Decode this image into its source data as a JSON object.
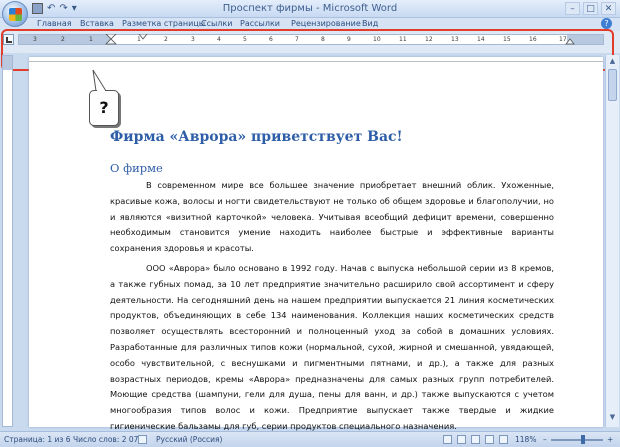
{
  "window": {
    "title": "Проспект фирмы - Microsoft Word",
    "controls": {
      "minimize": "–",
      "maximize": "□",
      "close": "✕"
    }
  },
  "qat": {
    "undo": "↶",
    "redo": "↷",
    "more": "▾"
  },
  "ribbon": {
    "tabs": [
      "Главная",
      "Вставка",
      "Разметка страницы",
      "Ссылки",
      "Рассылки",
      "Рецензирование",
      "Вид"
    ],
    "help": "?"
  },
  "ruler": {
    "ticks": [
      "3",
      "2",
      "1",
      "1",
      "2",
      "3",
      "4",
      "5",
      "6",
      "7",
      "8",
      "9",
      "10",
      "11",
      "12",
      "13",
      "14",
      "15",
      "16",
      "17"
    ]
  },
  "callout": {
    "text": "?"
  },
  "document": {
    "title": "Фирма «Аврора» приветствует Вас!",
    "subtitle": "О фирме",
    "paragraph1": "В современном мире все большее значение приобретает внешний облик. Ухоженные, красивые кожа, волосы и ногти свидетельствуют не только об общем здоровье и благополучии, но и являются «визитной карточкой» человека. Учитывая всеобщий дефицит времени, совершенно необходимым становится умение находить наиболее быстрые и эффективные варианты сохранения здоровья и красоты.",
    "paragraph2": "ООО «Аврора» было основано в 1992 году. Начав с выпуска небольшой серии из 8 кремов, а также губных помад, за 10 лет предприятие значительно расширило свой ассортимент и сферу деятельности. На сегодняшний день на нашем предприятии выпускается 21 линия косметических продуктов, объединяющих в себе 134 наименования. Коллекция наших косметических средств позволяет осуществлять всесторонний и полноценный уход за собой в домашних условиях. Разработанные для различных типов кожи (нормальной, сухой, жирной и смешанной, увядающей, особо чувствительной, с веснушками и пигментными пятнами, и др.), а также для разных возрастных периодов, кремы «Аврора» предназначены для самых разных групп потребителей. Моющие средства (шампуни, гели для душа, пены для ванн, и др.) также выпускаются с учетом многообразия типов волос и кожи. Предприятие выпускает также твердые и жидкие гигиенические бальзамы для губ, серии продуктов специального назначения."
  },
  "status": {
    "page": "Страница: 1 из 6",
    "words": "Число слов: 2 076",
    "language": "Русский (Россия)",
    "zoom": "118%",
    "zoom_minus": "–",
    "zoom_plus": "+"
  },
  "colors": {
    "highlight": "#e23c2a",
    "heading": "#2e5ea8"
  }
}
